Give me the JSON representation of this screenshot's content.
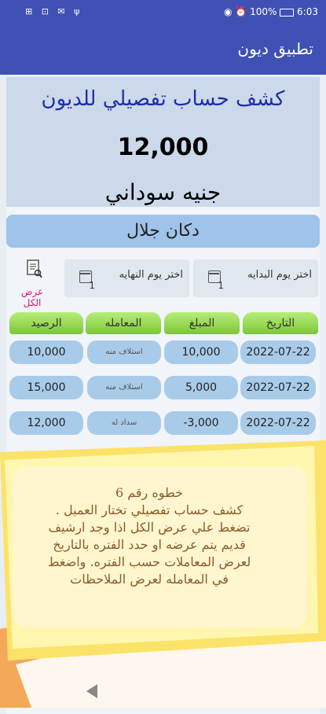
{
  "status_bar": {
    "time": "6:03",
    "battery": "100%",
    "left_icons": "⊞ ⊡ ✉ ψ",
    "right_icons": "◉ ⏰"
  },
  "app_bar": {
    "title": "تطبيق ديون"
  },
  "report": {
    "title": "كشف حساب تفصيلي للديون",
    "amount": "12,000",
    "currency": "جنيه سوداني",
    "customer": "دكان جلال"
  },
  "filters": {
    "start_date_label": "اختر يوم البدايه",
    "end_date_label": "اختر يوم النهايه",
    "calendar_day": "1",
    "show_all_label": "عرض الكل"
  },
  "table": {
    "headers": [
      "التاريخ",
      "المبلغ",
      "المعامله",
      "الرصيد"
    ],
    "rows": [
      {
        "date": "2022-07-22",
        "amount": "10,000",
        "type": "استلاف منه",
        "balance": "10,000"
      },
      {
        "date": "2022-07-22",
        "amount": "5,000",
        "type": "استلاف منه",
        "balance": "15,000"
      },
      {
        "date": "2022-07-22",
        "amount": "-3,000",
        "type": "سداد له",
        "balance": "12,000"
      }
    ]
  },
  "tip": {
    "lines": [
      "خطوه رقم 6",
      "كشف حساب تفصيلي تختار العميل .",
      "تضغط علي عرض الكل اذا وجد ارشيف",
      "قديم يتم عرضه او حدد الفتره بالتاريخ",
      "لعرض المعاملات حسب الفتره. واضغط",
      "في المعامله لعرض الملاحظات"
    ]
  },
  "colors": {
    "primary": "#3f51b5",
    "header_card": "#cbd9ea",
    "customer_bar": "#9fc3ea",
    "table_header": "#8fd44a",
    "cell": "#a9cbea",
    "tip_yellow": "#fff09a",
    "tip_orange": "#f4a85a",
    "show_all": "#e0157a"
  }
}
